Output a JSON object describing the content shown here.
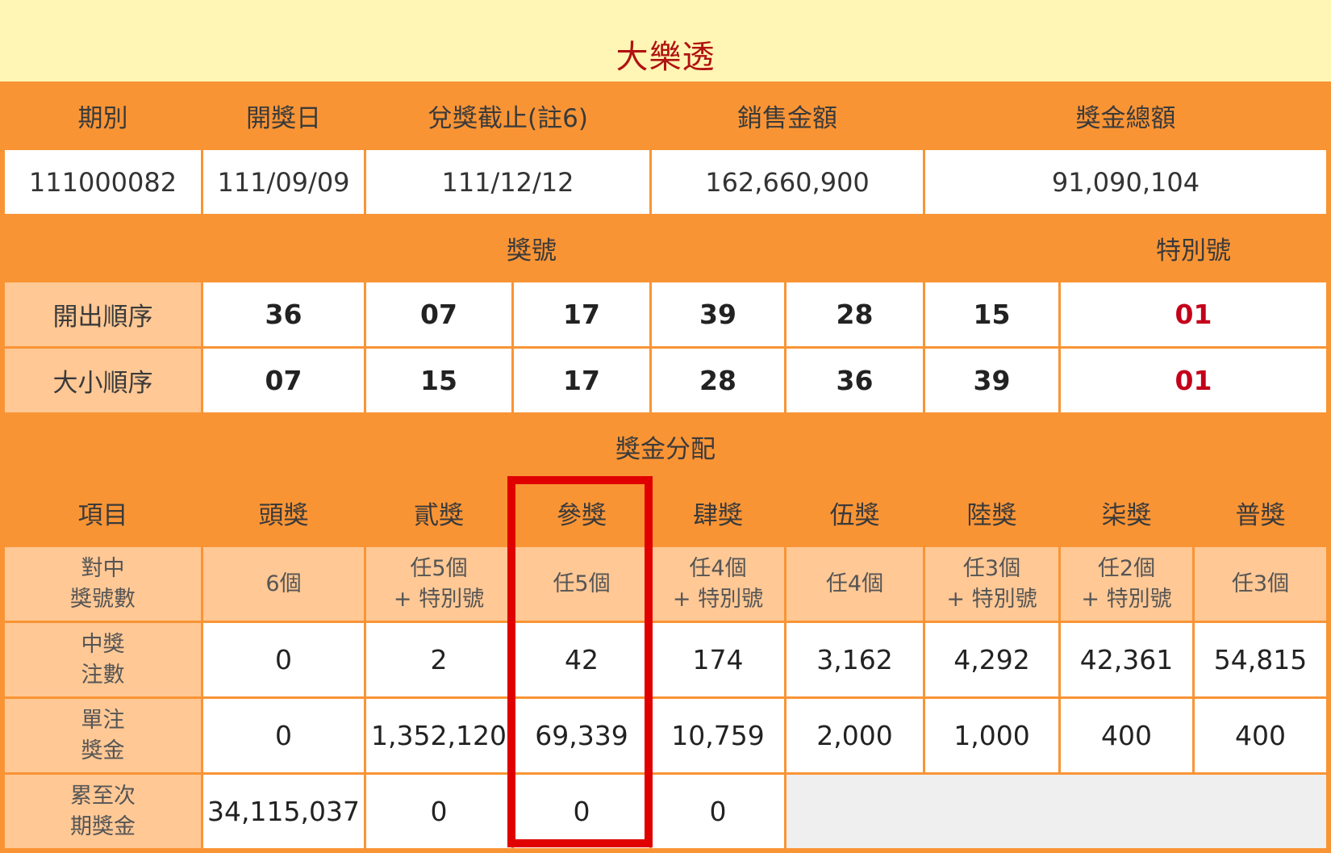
{
  "title": "大樂透",
  "header": {
    "period_label": "期別",
    "draw_date_label": "開獎日",
    "claim_deadline_label": "兌獎截止(註6)",
    "sales_label": "銷售金額",
    "prize_total_label": "獎金總額"
  },
  "summary": {
    "period": "111000082",
    "draw_date": "111/09/09",
    "claim_deadline": "111/12/12",
    "sales": "162,660,900",
    "prize_total": "91,090,104"
  },
  "numbers_header": {
    "winning_numbers_label": "獎號",
    "special_number_label": "特別號"
  },
  "draw_order": {
    "label": "開出順序",
    "numbers": [
      "36",
      "07",
      "17",
      "39",
      "28",
      "15"
    ],
    "special": "01"
  },
  "size_order": {
    "label": "大小順序",
    "numbers": [
      "07",
      "15",
      "17",
      "28",
      "36",
      "39"
    ],
    "special": "01"
  },
  "distribution_title": "獎金分配",
  "prize_table": {
    "item_label": "項目",
    "tiers": [
      "頭獎",
      "貳獎",
      "參獎",
      "肆獎",
      "伍獎",
      "陸獎",
      "柒獎",
      "普獎"
    ],
    "match_label": [
      "對中",
      "獎號數"
    ],
    "match": [
      [
        "6個"
      ],
      [
        "任5個",
        "+ 特別號"
      ],
      [
        "任5個"
      ],
      [
        "任4個",
        "+ 特別號"
      ],
      [
        "任4個"
      ],
      [
        "任3個",
        "+ 特別號"
      ],
      [
        "任2個",
        "+ 特別號"
      ],
      [
        "任3個"
      ]
    ],
    "winners_label": [
      "中獎",
      "注數"
    ],
    "winners": [
      "0",
      "2",
      "42",
      "174",
      "3,162",
      "4,292",
      "42,361",
      "54,815"
    ],
    "prize_label": [
      "單注",
      "獎金"
    ],
    "prize_per_ticket": [
      "0",
      "1,352,120",
      "69,339",
      "10,759",
      "2,000",
      "1,000",
      "400",
      "400"
    ],
    "carryover_label": [
      "累至次",
      "期獎金"
    ],
    "carryover": [
      "34,115,037",
      "0",
      "0",
      "0"
    ]
  },
  "colors": {
    "header_orange": "#f99435",
    "light_orange": "#ffc895",
    "title_yellow": "#fff5b4",
    "title_red": "#b01212",
    "special_red": "#c4001a",
    "highlight_red": "#e00000"
  }
}
